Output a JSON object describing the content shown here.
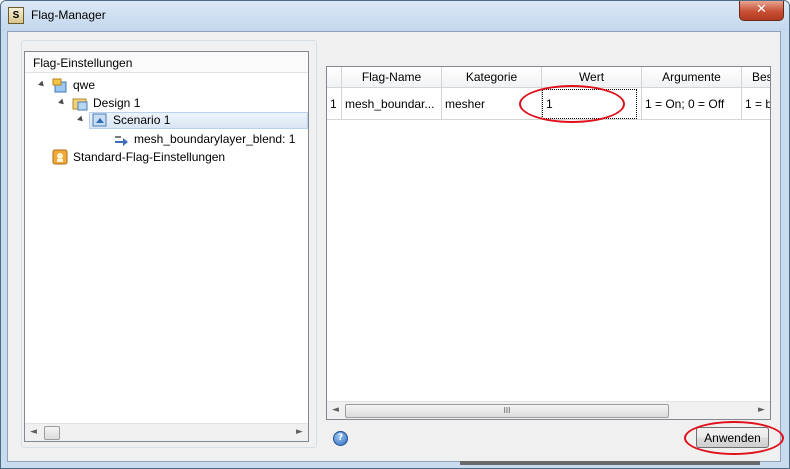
{
  "window": {
    "title": "Flag-Manager",
    "app_icon_text": "S",
    "close_glyph": "✕"
  },
  "tree": {
    "header": "Flag-Einstellungen",
    "items": [
      {
        "label": "qwe",
        "icon": "database-icon"
      },
      {
        "label": "Design 1",
        "icon": "design-folder-icon"
      },
      {
        "label": "Scenario 1",
        "icon": "scenario-icon"
      },
      {
        "label": "mesh_boundarylayer_blend: 1",
        "icon": "flag-arrow-icon"
      },
      {
        "label": "Standard-Flag-Einstellungen",
        "icon": "default-flags-icon"
      }
    ],
    "scroll_left": "◄",
    "scroll_right": "►"
  },
  "grid": {
    "columns": [
      "Flag-Name",
      "Kategorie",
      "Wert",
      "Argumente",
      "Bes"
    ],
    "rows": [
      {
        "num": "1",
        "flag_name": "mesh_boundar...",
        "category": "mesher",
        "value": "1",
        "arguments": "1 = On; 0 = Off",
        "description": "1 = b"
      }
    ],
    "scroll_left": "◄",
    "scroll_right": "►",
    "thumb_grip": "III"
  },
  "footer": {
    "help_glyph": "?",
    "apply_label": "Anwenden"
  },
  "colors": {
    "annotation_red": "#e0101a",
    "title_blue": "#c3d7ec",
    "close_red": "#c74f34"
  }
}
